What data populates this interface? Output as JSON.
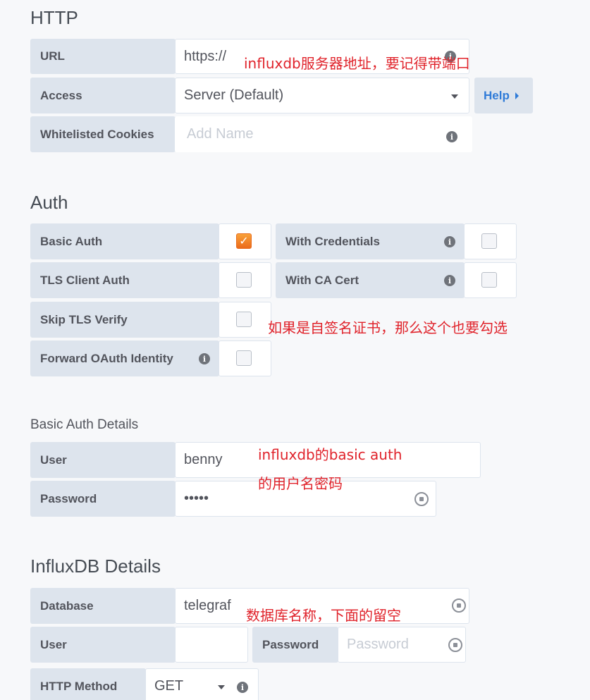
{
  "http": {
    "title": "HTTP",
    "url_label": "URL",
    "url_value": "https://",
    "access_label": "Access",
    "access_value": "Server (Default)",
    "help_label": "Help",
    "cookies_label": "Whitelisted Cookies",
    "cookies_placeholder": "Add Name"
  },
  "auth": {
    "title": "Auth",
    "basic_auth_label": "Basic Auth",
    "basic_auth_checked": true,
    "with_credentials_label": "With Credentials",
    "with_credentials_checked": false,
    "tls_client_auth_label": "TLS Client Auth",
    "tls_client_auth_checked": false,
    "with_ca_cert_label": "With CA Cert",
    "with_ca_cert_checked": false,
    "skip_tls_label": "Skip TLS Verify",
    "skip_tls_checked": false,
    "forward_oauth_label": "Forward OAuth Identity",
    "forward_oauth_checked": false
  },
  "basic_auth_details": {
    "title": "Basic Auth Details",
    "user_label": "User",
    "user_value": "benny",
    "password_label": "Password",
    "password_value": "•••••"
  },
  "influxdb": {
    "title": "InfluxDB Details",
    "database_label": "Database",
    "database_value": "telegraf",
    "user_label": "User",
    "user_value": "",
    "password_label": "Password",
    "password_placeholder": "Password",
    "method_label": "HTTP Method",
    "method_value": "GET"
  },
  "annotations": {
    "url_note": "influxdb服务器地址，要记得带端口",
    "tls_note": "如果是自签名证书，那么这个也要勾选",
    "auth_note_line1": "influxdb的basic auth",
    "auth_note_line2": "的用户名密码",
    "db_note": "数据库名称，下面的留空"
  },
  "colors": {
    "accent_orange": "#eb6a1a",
    "link_blue": "#2f7bd8",
    "annotation_red": "#e0232b",
    "label_bg": "#dde4ed"
  }
}
